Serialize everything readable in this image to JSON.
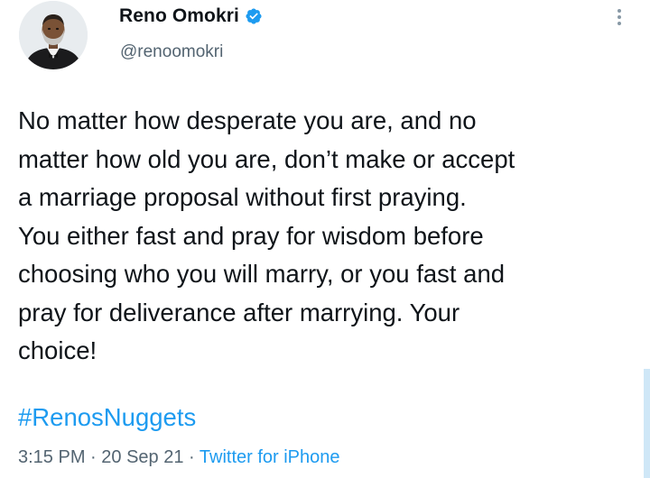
{
  "author": {
    "display_name": "Reno Omokri",
    "handle": "@renoomokri",
    "verified": true,
    "avatar_icon": "profile-photo-icon",
    "verified_icon": "verified-badge-icon"
  },
  "tweet": {
    "text_lines": [
      "No matter how desperate you are, and no",
      "matter how old you are, don’t make or accept",
      "a marriage proposal without first praying.",
      "You either fast and pray for wisdom before",
      "choosing who you will marry, or you fast and",
      "pray for deliverance after marrying. Your",
      "choice!"
    ],
    "hashtag": "#RenosNuggets",
    "time": "3:15 PM",
    "separator": " · ",
    "date": "20 Sep 21",
    "source": "Twitter for iPhone"
  },
  "ui": {
    "more_icon": "more-vertical-icon"
  },
  "colors": {
    "link": "#1d9bf0",
    "text": "#0f1419",
    "secondary_text": "#536471",
    "verified": "#1d9bf0"
  }
}
